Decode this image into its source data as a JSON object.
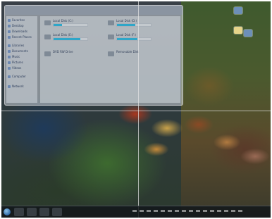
{
  "window": {
    "title": "",
    "sidebar_items": [
      {
        "label": "Favorites"
      },
      {
        "label": "Desktop"
      },
      {
        "label": "Downloads"
      },
      {
        "label": "Recent Places"
      },
      {
        "label": "Libraries"
      },
      {
        "label": "Documents"
      },
      {
        "label": "Music"
      },
      {
        "label": "Pictures"
      },
      {
        "label": "Videos"
      },
      {
        "label": "Computer"
      },
      {
        "label": "Network"
      }
    ],
    "drives": [
      {
        "name": "Local Disk (C:)",
        "info": "",
        "usage": 0.25
      },
      {
        "name": "Local Disk (D:)",
        "info": "",
        "usage": 0.55
      },
      {
        "name": "Local Disk (E:)",
        "info": "",
        "usage": 0.8
      },
      {
        "name": "Local Disk (F:)",
        "info": "",
        "usage": 0.6
      },
      {
        "name": "DVD RW Drive",
        "info": "",
        "usage": 0
      },
      {
        "name": "Removable Disk",
        "info": "",
        "usage": 0
      }
    ]
  },
  "taskbar": {
    "clock": ""
  },
  "icons": {
    "start": "windows-orb-icon",
    "folder": "folder-icon",
    "drive": "hard-drive-icon"
  },
  "colors": {
    "usage_bar": "#2fa6c8",
    "taskbar": "#12161a"
  }
}
